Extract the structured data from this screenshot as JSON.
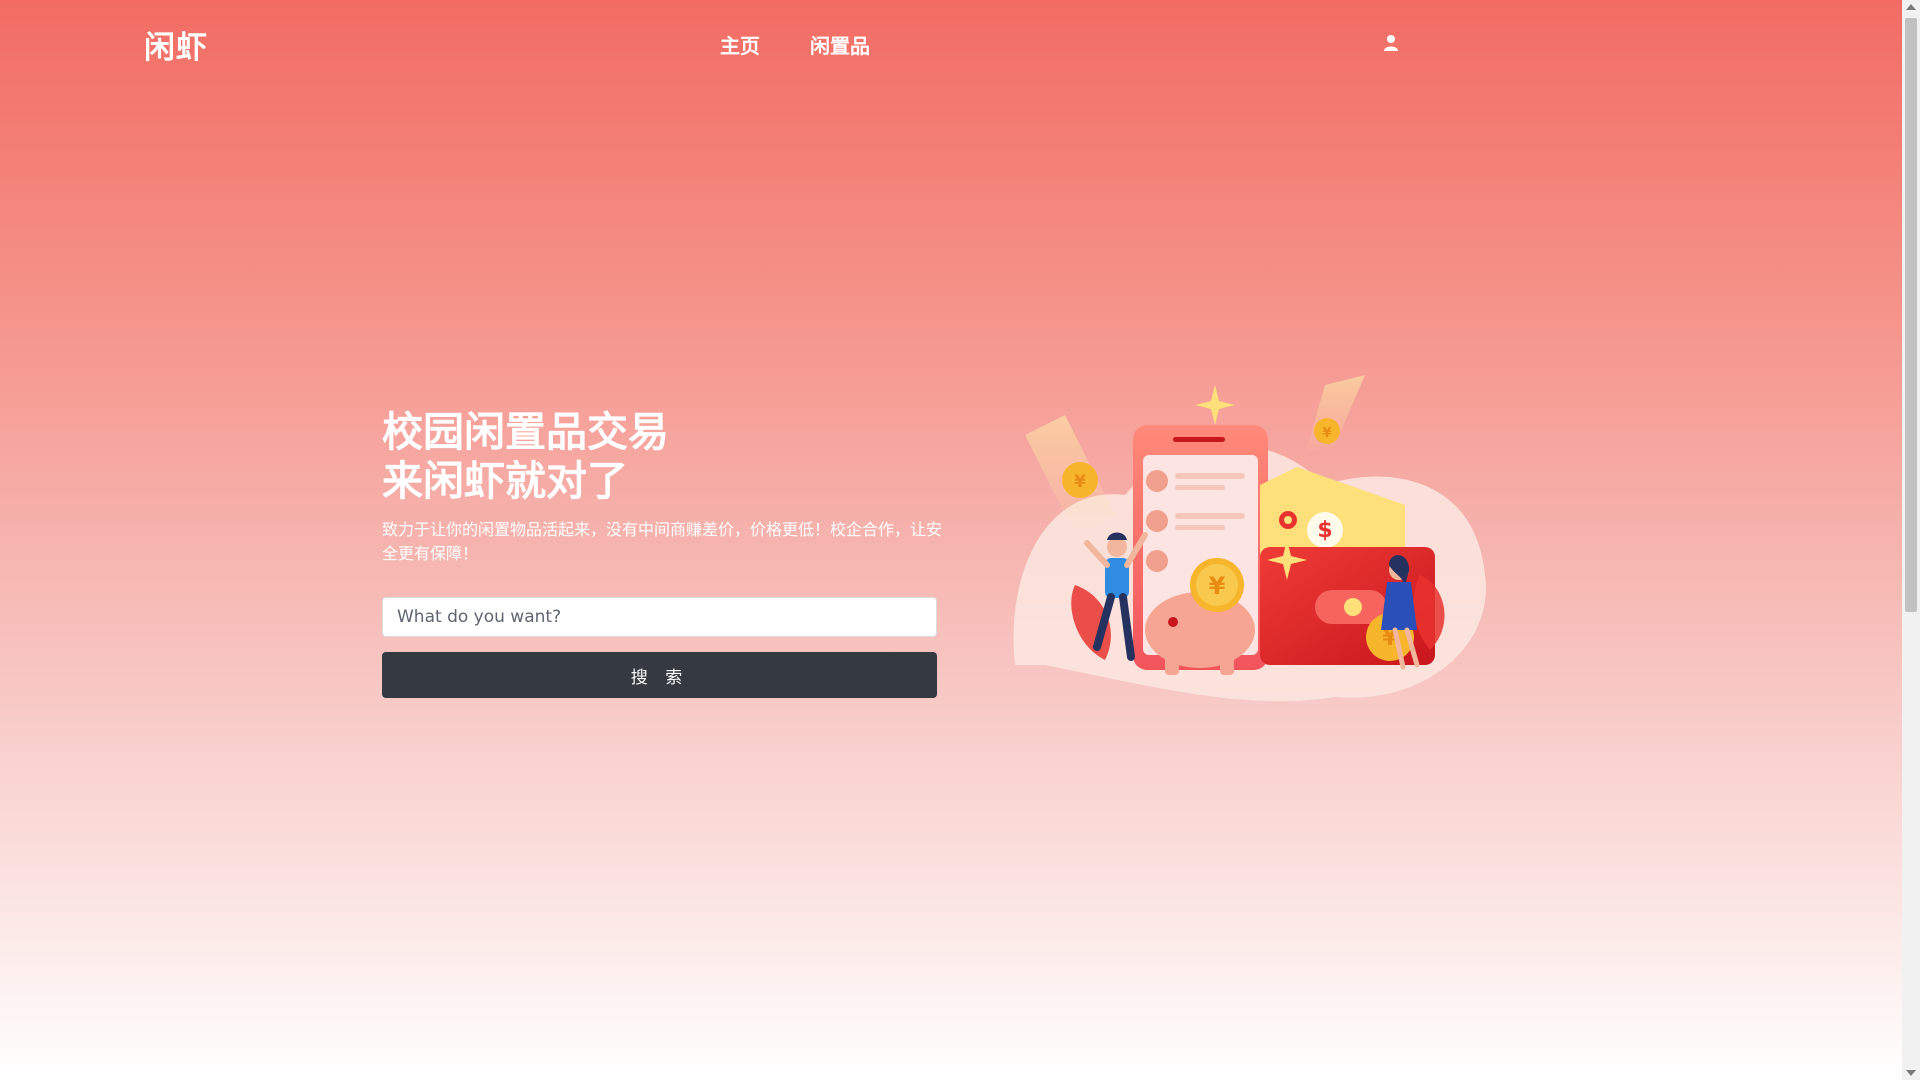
{
  "nav": {
    "brand": "闲虾",
    "links": [
      {
        "label": "主页"
      },
      {
        "label": "闲置品"
      }
    ],
    "user_icon": "user-icon"
  },
  "hero": {
    "title_line1": "校园闲置品交易",
    "title_line2": "来闲虾就对了",
    "subtitle": "致力于让你的闲置物品活起来，没有中间商赚差价，价格更低！校企合作，让安全更有保障！",
    "search_placeholder": "What do you want?",
    "search_button": "搜 索"
  },
  "illustration": {
    "currency_symbols": [
      "¥",
      "¥",
      "¥",
      "¥",
      "$"
    ]
  },
  "colors": {
    "gradient_top": "#f26c63",
    "gradient_bottom": "#ffffff",
    "button_bg": "#343a40",
    "accent_red": "#e8322f",
    "coin_gold": "#f7b52c"
  }
}
